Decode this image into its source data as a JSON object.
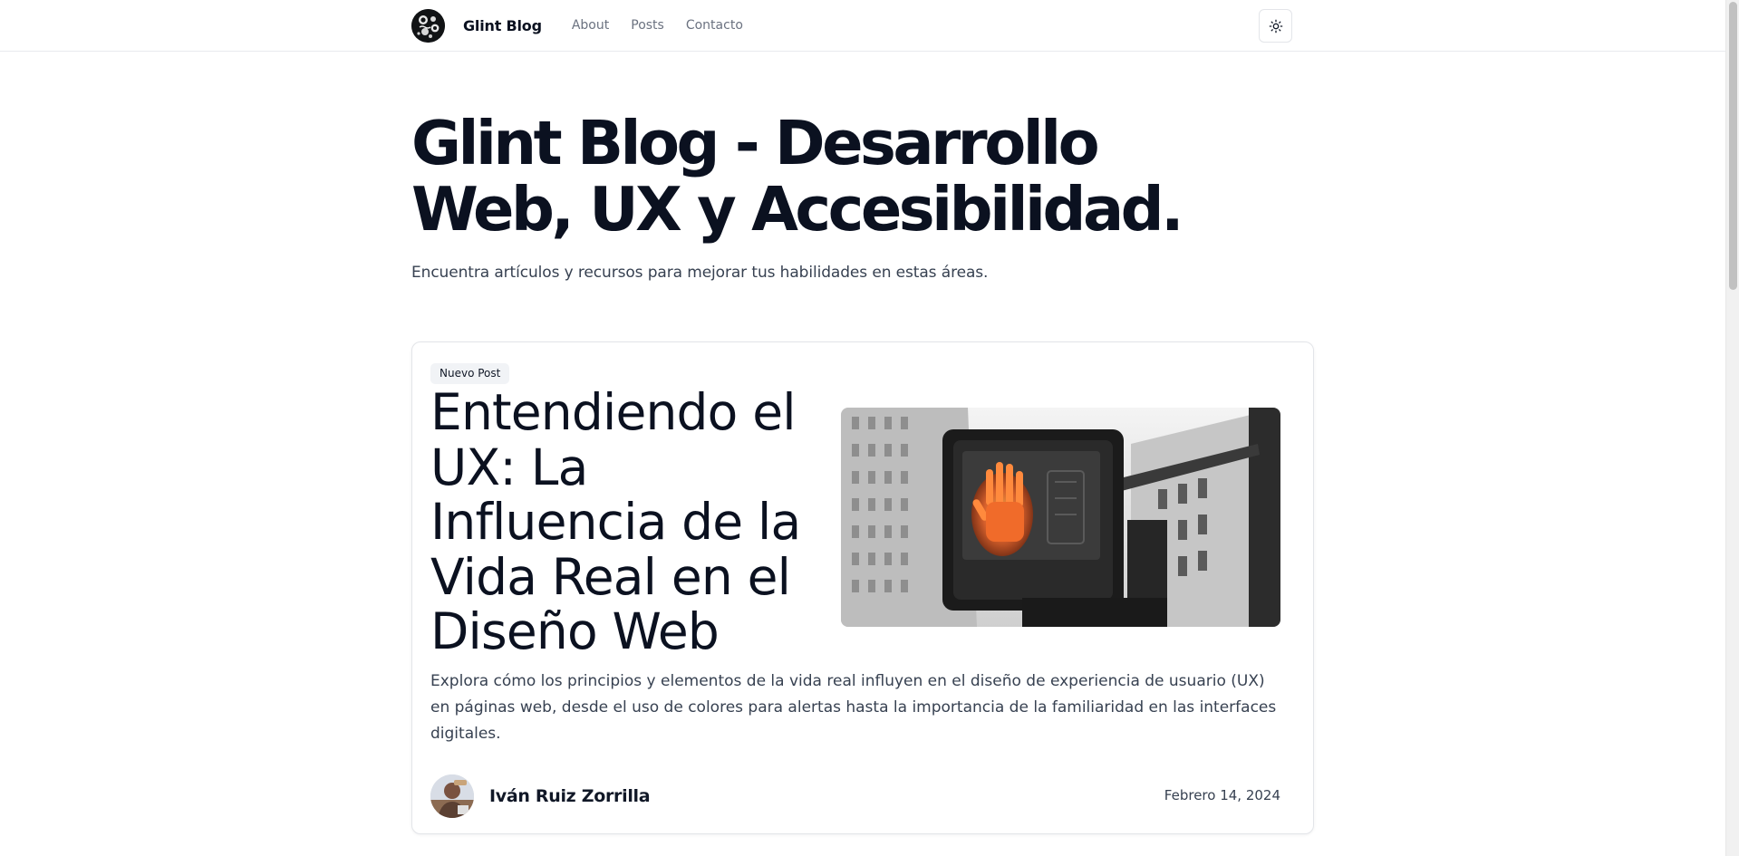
{
  "header": {
    "brand": "Glint Blog",
    "nav": [
      "About",
      "Posts",
      "Contacto"
    ],
    "theme_toggle_icon": "sun-icon"
  },
  "hero": {
    "title_line1": "Glint Blog - Desarrollo",
    "title_line2": "Web, UX y Accesibilidad.",
    "subtitle": "Encuentra artículos y recursos para mejorar tus habilidades en estas áreas."
  },
  "featured_post": {
    "badge": "Nuevo Post",
    "title": "Entendiendo el UX: La Influencia de la Vida Real en el Diseño Web",
    "excerpt": "Explora cómo los principios y elementos de la vida real influyen en el diseño de experiencia de usuario (UX) en páginas web, desde el uso de colores para alertas hasta la importancia de la familiaridad en las interfaces digitales.",
    "author": "Iván Ruiz Zorrilla",
    "date": "Febrero 14, 2024"
  },
  "colors": {
    "text": "#0b1120",
    "muted": "#6b7280",
    "border": "#e3e5e9",
    "signal_orange": "#e8642a"
  }
}
